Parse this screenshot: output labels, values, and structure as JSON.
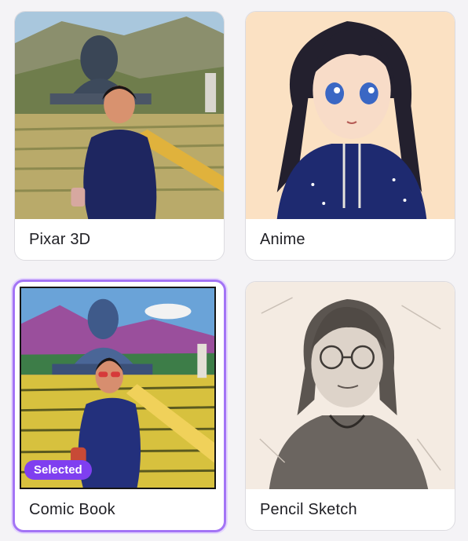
{
  "styles": [
    {
      "label": "Pixar 3D",
      "selected": false
    },
    {
      "label": "Anime",
      "selected": false
    },
    {
      "label": "Comic Book",
      "selected": true
    },
    {
      "label": "Pencil Sketch",
      "selected": false
    }
  ],
  "selected_badge": "Selected",
  "colors": {
    "accent": "#a374f5",
    "badge": "#7f3ff0",
    "card_bg": "#ffffff",
    "page_bg": "#f4f3f6"
  }
}
